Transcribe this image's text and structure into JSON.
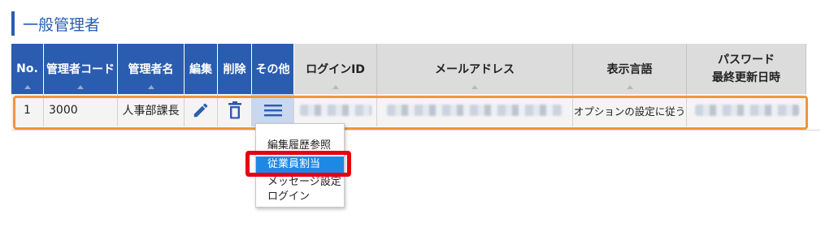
{
  "section": {
    "title": "一般管理者"
  },
  "table": {
    "headers": {
      "no": "No.",
      "code": "管理者コード",
      "name": "管理者名",
      "edit": "編集",
      "delete": "削除",
      "other": "その他",
      "login_id": "ログインID",
      "email": "メールアドレス",
      "language": "表示言語",
      "pw_line1": "パスワード",
      "pw_line2": "最終更新日時"
    },
    "row": {
      "no": "1",
      "code": "3000",
      "name": "人事部課長",
      "language": "オプションの設定に従う"
    }
  },
  "context_menu": {
    "items": [
      {
        "label": "編集履歴参照"
      },
      {
        "label": "従業員割当"
      },
      {
        "label": "メッセージ設定"
      },
      {
        "label": "ログイン"
      }
    ],
    "selected_index": 1
  },
  "colors": {
    "header_blue": "#2a5db0",
    "row_highlight_border": "#f0973a",
    "annotation_red": "#e60012",
    "menu_selected": "#1e88e5"
  },
  "icons": {
    "edit": "pencil-icon",
    "delete": "trash-icon",
    "other": "hamburger-menu-icon"
  }
}
